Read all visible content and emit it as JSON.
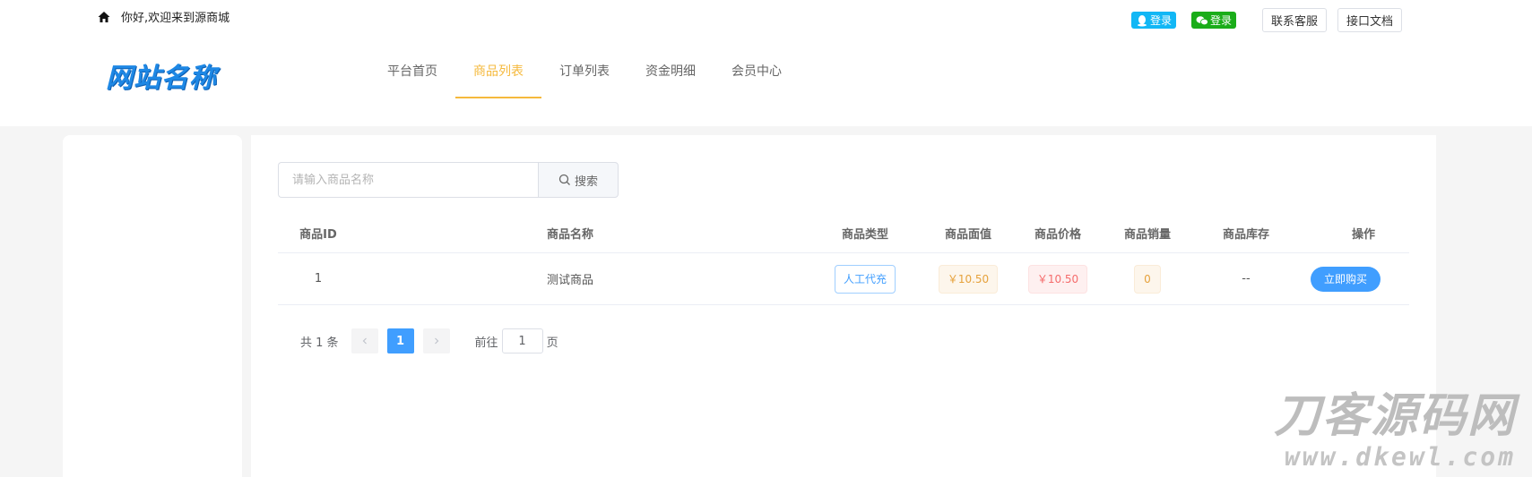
{
  "topbar": {
    "welcome": "你好,欢迎来到源商城",
    "qq_login": "登录",
    "wechat_login": "登录",
    "contact": "联系客服",
    "api_docs": "接口文档"
  },
  "logo": "网站名称",
  "nav": {
    "items": [
      {
        "label": "平台首页"
      },
      {
        "label": "商品列表"
      },
      {
        "label": "订单列表"
      },
      {
        "label": "资金明细"
      },
      {
        "label": "会员中心"
      }
    ],
    "active_index": 1
  },
  "search": {
    "placeholder": "请输入商品名称",
    "button": "搜索"
  },
  "table": {
    "headers": {
      "id": "商品ID",
      "name": "商品名称",
      "type": "商品类型",
      "face": "商品面值",
      "price": "商品价格",
      "sales": "商品销量",
      "stock": "商品库存",
      "op": "操作"
    },
    "rows": [
      {
        "id": "1",
        "name": "测试商品",
        "type": "人工代充",
        "face": "￥10.50",
        "price": "￥10.50",
        "sales": "0",
        "stock": "--",
        "action": "立即购买"
      }
    ]
  },
  "pager": {
    "total": "共 1 条",
    "current": "1",
    "goto_prefix": "前往",
    "goto_value": "1",
    "goto_suffix": "页"
  },
  "watermark": {
    "main": "刀客源码网",
    "sub": "www.dkewl.com"
  },
  "colors": {
    "accent": "#f5b93c",
    "primary": "#409eff",
    "logo": "#1e88e5",
    "qq": "#12b7f5",
    "wechat": "#1aad19"
  }
}
